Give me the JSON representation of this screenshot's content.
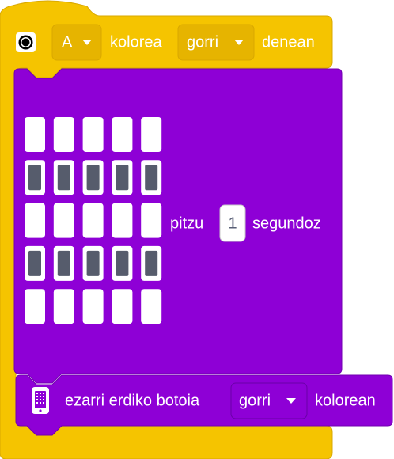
{
  "colors": {
    "event_block": "#f5c400",
    "event_block_border": "#d9a800",
    "event_dropdown": "#e6b400",
    "display_block": "#8e00d6",
    "display_block_border": "#7100b0",
    "led_off": "#ffffff",
    "led_on": "#565c6c",
    "number_text": "#575e75"
  },
  "hat_block": {
    "icon": "record-circle-icon",
    "button_select": "A",
    "label_color": "kolorea",
    "color_select": "gorri",
    "label_when": "denean"
  },
  "show_block": {
    "led_grid": [
      [
        0,
        0,
        0,
        0,
        0
      ],
      [
        1,
        1,
        1,
        1,
        1
      ],
      [
        0,
        0,
        0,
        0,
        0
      ],
      [
        1,
        1,
        1,
        1,
        1
      ],
      [
        0,
        0,
        0,
        0,
        0
      ]
    ],
    "label_light": "pitzu",
    "seconds_value": "1",
    "label_seconds": "segundoz"
  },
  "set_block": {
    "icon": "led-matrix-icon",
    "label": "ezarri erdiko botoia",
    "color_select": "gorri",
    "label_suffix": "kolorean"
  }
}
